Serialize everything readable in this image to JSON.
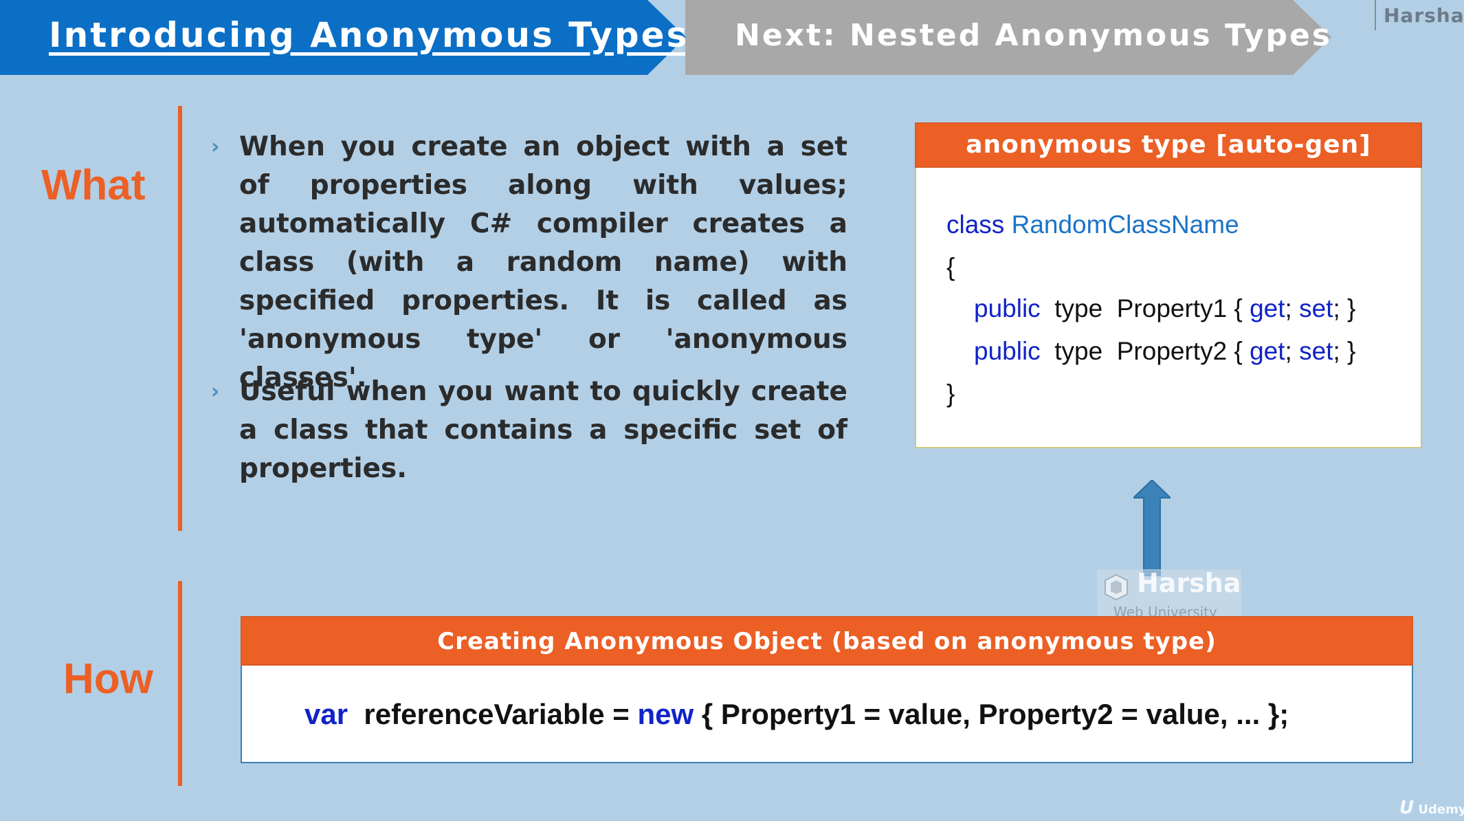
{
  "header": {
    "current_tab": "Introducing Anonymous Types",
    "next_tab": "Next: Nested Anonymous Types",
    "author": "Harsha"
  },
  "sections": {
    "what_label": "What",
    "how_label": "How"
  },
  "bullets": [
    {
      "marker": "›",
      "text": "When you create an object with a set of properties along with values; automatically C# compiler creates a class (with a random name) with specified properties. It is called as 'anonymous type' or 'anonymous classes'."
    },
    {
      "marker": "›",
      "text": "Useful when you want to quickly create a class that contains a specific set of properties."
    }
  ],
  "anonymous_type_panel": {
    "title": "anonymous type [auto-gen]",
    "code": {
      "kw_class": "class",
      "class_name": "RandomClassName",
      "open_brace": "{",
      "kw_public": "public",
      "kw_get": "get",
      "kw_set": "set",
      "prop1_pre": "type  Property1 { ",
      "prop2_pre": "type  Property2 { ",
      "sep": "; ",
      "end": "; }",
      "close_brace": "}"
    }
  },
  "creation_panel": {
    "title": "Creating Anonymous Object (based on anonymous type)",
    "code": {
      "kw_var": "var",
      "middle": "  referenceVariable = ",
      "kw_new": "new",
      "rest": " { Property1 = value, Property2 = value, ... };"
    }
  },
  "watermark": {
    "title": "Harsha",
    "subtitle": "Web University"
  },
  "footer": {
    "brand_mark": "U",
    "brand": "Udemy"
  },
  "colors": {
    "background": "#b2cfe6",
    "current_tab": "#0b6fc6",
    "next_tab": "#a8a8a8",
    "accent_orange": "#ec5f25",
    "keyword_blue": "#1023c8",
    "classname_blue": "#1a73c8",
    "arrow_blue": "#3a82b8"
  },
  "icons": {
    "arrow": "up-arrow-icon",
    "bullet": "chevron-right-icon",
    "watermark_logo": "harsha-logo-icon"
  }
}
